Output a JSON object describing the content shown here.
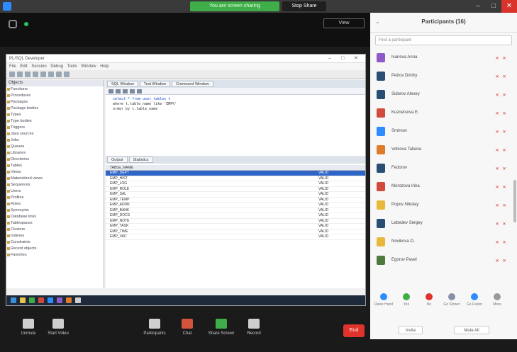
{
  "window": {
    "share_banner": "You are screen sharing",
    "stop_share": "Stop Share",
    "controls": {
      "min": "–",
      "max": "□",
      "close": "✕"
    }
  },
  "meeting": {
    "view_button": "View"
  },
  "shared_app": {
    "title": "PL/SQL Developer",
    "controls": "– □ ✕",
    "menu": "File Edit Session Debug Tools Window Help",
    "tree_header": "Objects",
    "tree_items": [
      "Functions",
      "Procedures",
      "Packages",
      "Package bodies",
      "Types",
      "Type bodies",
      "Triggers",
      "Java sources",
      "Jobs",
      "Queues",
      "Libraries",
      "Directories",
      "Tables",
      "Views",
      "Materialized views",
      "Sequences",
      "Users",
      "Profiles",
      "Roles",
      "Synonyms",
      "Database links",
      "Tablespaces",
      "Clusters",
      "Indexes",
      "Constraints",
      "Recent objects",
      "Favorites"
    ],
    "editor_tabs": [
      "SQL Window",
      "Test Window",
      "Command Window"
    ],
    "code_lines": [
      "select * from user_tables t",
      "where t.table_name like 'EMP%'",
      "order by t.table_name"
    ],
    "results_tabs": [
      "Output",
      "Statistics"
    ],
    "results_header": "TABLE_NAME",
    "results_rows": [
      {
        "c1": "EMP_DEPT",
        "c2": "VALID"
      },
      {
        "c1": "EMP_HIST",
        "c2": "VALID"
      },
      {
        "c1": "EMP_LOG",
        "c2": "VALID"
      },
      {
        "c1": "EMP_ROLE",
        "c2": "VALID"
      },
      {
        "c1": "EMP_SAL",
        "c2": "VALID"
      },
      {
        "c1": "EMP_TEMP",
        "c2": "VALID"
      },
      {
        "c1": "EMP_ADDR",
        "c2": "VALID"
      },
      {
        "c1": "EMP_BANK",
        "c2": "VALID"
      },
      {
        "c1": "EMP_DOCS",
        "c2": "VALID"
      },
      {
        "c1": "EMP_NOTE",
        "c2": "VALID"
      },
      {
        "c1": "EMP_TASK",
        "c2": "VALID"
      },
      {
        "c1": "EMP_TIME",
        "c2": "VALID"
      },
      {
        "c1": "EMP_VAC",
        "c2": "VALID"
      }
    ]
  },
  "toolbar": {
    "items": [
      {
        "label": "Unmute",
        "color": "#cfcfcf"
      },
      {
        "label": "Start Video",
        "color": "#cfcfcf"
      },
      {
        "label": "Participants",
        "color": "#cfcfcf"
      },
      {
        "label": "Chat",
        "color": "#d2543c"
      },
      {
        "label": "Share Screen",
        "color": "#3fae49"
      },
      {
        "label": "Record",
        "color": "#cfcfcf"
      }
    ],
    "end": "End"
  },
  "panel": {
    "title": "Participants (16)",
    "search_placeholder": "Find a participant",
    "participants": [
      {
        "name": "Ivanova Anna",
        "color": "#8e5ac8"
      },
      {
        "name": "Petrov Dmitry",
        "color": "#2a4d73"
      },
      {
        "name": "Sidorov Alexey",
        "color": "#2a4d73"
      },
      {
        "name": "Kuznetsova E.",
        "color": "#d24a3c"
      },
      {
        "name": "Smirnov",
        "color": "#2d8cff"
      },
      {
        "name": "Volkova Tatiana",
        "color": "#e07b2a"
      },
      {
        "name": "Fedorov",
        "color": "#2a4d73"
      },
      {
        "name": "Morozova Irina",
        "color": "#d24a3c"
      },
      {
        "name": "Popov Nikolay",
        "color": "#e8b83a"
      },
      {
        "name": "Lebedev Sergey",
        "color": "#2a4d73"
      },
      {
        "name": "Novikova O.",
        "color": "#e8b83a"
      },
      {
        "name": "Egorov Pavel",
        "color": "#4f7a3e"
      }
    ],
    "reactions": [
      {
        "label": "Raise Hand",
        "color": "#2d8cff"
      },
      {
        "label": "Yes",
        "color": "#3fae49"
      },
      {
        "label": "No",
        "color": "#e0332b"
      },
      {
        "label": "Go Slower",
        "color": "#8a8fa8"
      },
      {
        "label": "Go Faster",
        "color": "#2d8cff"
      },
      {
        "label": "More",
        "color": "#999"
      }
    ],
    "invite": "Invite",
    "mute_all": "Mute All"
  }
}
